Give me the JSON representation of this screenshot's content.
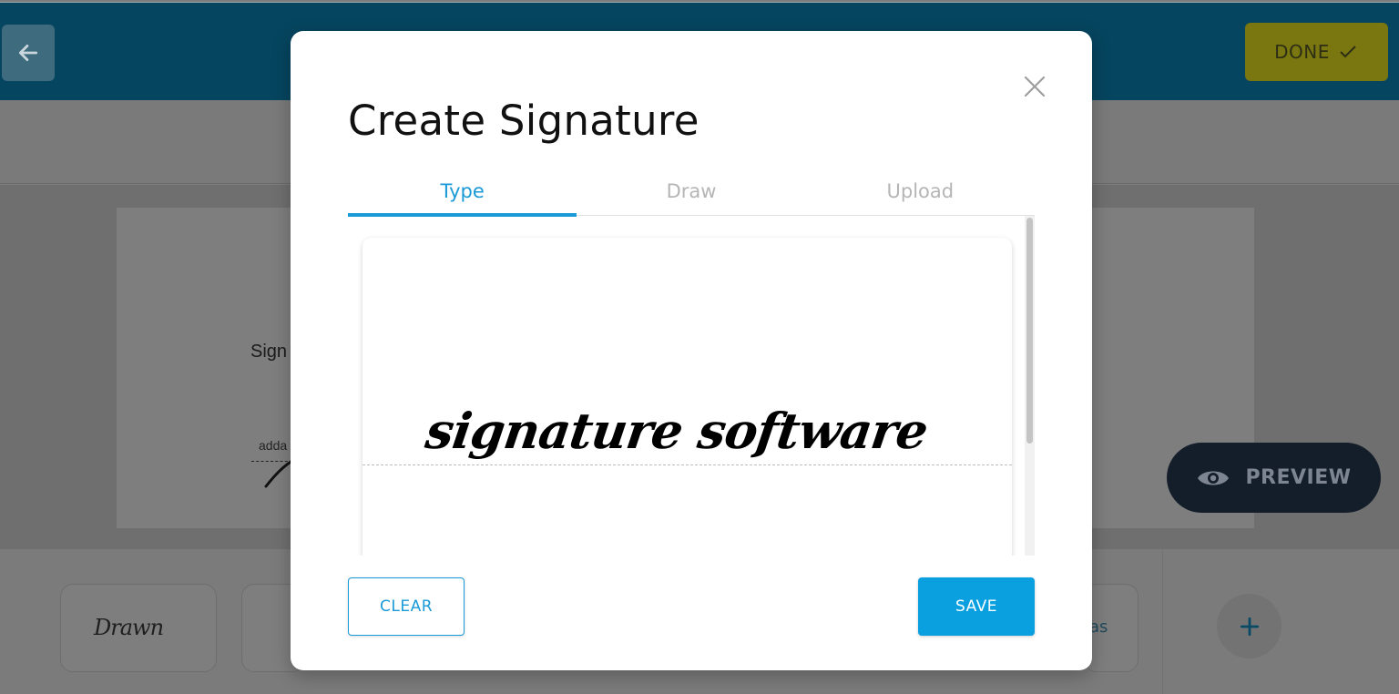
{
  "app": {
    "back_icon": "arrow-left-icon",
    "done_label": "DONE",
    "done_icon": "check-icon",
    "doc_text": "Sign",
    "doc_sig_label": "adda",
    "preview_label": "PREVIEW",
    "preview_icon": "eye-icon",
    "tray": {
      "drawn_label": "Drawn",
      "partial_label": "as",
      "add_icon": "plus-icon"
    }
  },
  "modal": {
    "title": "Create Signature",
    "close_icon": "close-icon",
    "tabs": [
      {
        "label": "Type",
        "active": true
      },
      {
        "label": "Draw",
        "active": false
      },
      {
        "label": "Upload",
        "active": false
      }
    ],
    "signature_text": "signature software",
    "clear_label": "CLEAR",
    "save_label": "SAVE"
  },
  "colors": {
    "accent": "#1a9ad6",
    "save_bg": "#0aa0e0",
    "topbar": "#06455f",
    "done_bg": "#7a7610"
  }
}
